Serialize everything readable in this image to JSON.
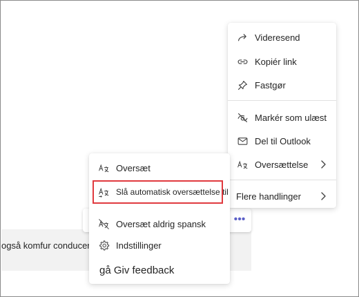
{
  "chat": {
    "message_text": "også komfur conducer"
  },
  "toolbar": {
    "more_icon": "more-horizontal-icon",
    "more_glyph": "•••",
    "accent": "#5b5fc7"
  },
  "main_menu": {
    "items": [
      {
        "label": "Videresend",
        "icon": "forward-arrow-icon"
      },
      {
        "label": "Kopiér link",
        "icon": "link-icon"
      },
      {
        "label": "Fastgør",
        "icon": "pin-icon"
      },
      {
        "label": "Markér som ulæst",
        "icon": "unread-eye-icon"
      },
      {
        "label": "Del til Outlook",
        "icon": "mail-icon"
      },
      {
        "label": "Oversættelse",
        "icon": "translate-icon",
        "has_submenu": true
      },
      {
        "label": "Flere handlinger",
        "has_submenu": true
      }
    ]
  },
  "translate_menu": {
    "items": [
      {
        "label": "Oversæt",
        "icon": "translate-icon"
      },
      {
        "label": "Slå automatisk oversættelse til",
        "icon": "auto-translate-icon",
        "highlighted": true
      },
      {
        "label": "Oversæt aldrig spansk",
        "icon": "translate-off-icon"
      },
      {
        "label": "Indstillinger",
        "icon": "gear-icon"
      },
      {
        "label": "gå Giv feedback"
      }
    ]
  },
  "colors": {
    "highlight_border": "#e0393e",
    "menu_bg": "#ffffff",
    "bubble_bg": "#f2f2f2"
  }
}
